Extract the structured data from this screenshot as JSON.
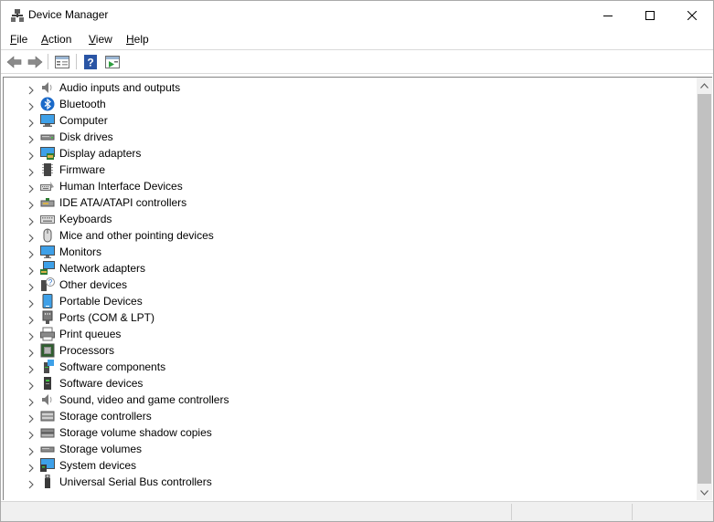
{
  "window": {
    "title": "Device Manager",
    "app_icon": "device-manager-icon"
  },
  "menu": [
    {
      "label": "File",
      "mnemonic": "F",
      "rest": "ile"
    },
    {
      "label": "Action",
      "mnemonic": "A",
      "rest": "ction"
    },
    {
      "label": "View",
      "mnemonic": "V",
      "rest": "iew"
    },
    {
      "label": "Help",
      "mnemonic": "H",
      "rest": "elp"
    }
  ],
  "toolbar": {
    "buttons": [
      "back-arrow-icon",
      "forward-arrow-icon",
      "properties-icon",
      "help-icon",
      "scan-hardware-icon"
    ]
  },
  "tree": {
    "items": [
      {
        "label": "Audio inputs and outputs",
        "icon": "speaker-icon"
      },
      {
        "label": "Bluetooth",
        "icon": "bluetooth-icon"
      },
      {
        "label": "Computer",
        "icon": "computer-icon"
      },
      {
        "label": "Disk drives",
        "icon": "disk-drive-icon"
      },
      {
        "label": "Display adapters",
        "icon": "display-adapter-icon"
      },
      {
        "label": "Firmware",
        "icon": "firmware-chip-icon"
      },
      {
        "label": "Human Interface Devices",
        "icon": "hid-icon"
      },
      {
        "label": "IDE ATA/ATAPI controllers",
        "icon": "ide-controller-icon"
      },
      {
        "label": "Keyboards",
        "icon": "keyboard-icon"
      },
      {
        "label": "Mice and other pointing devices",
        "icon": "mouse-icon"
      },
      {
        "label": "Monitors",
        "icon": "monitor-icon"
      },
      {
        "label": "Network adapters",
        "icon": "network-adapter-icon"
      },
      {
        "label": "Other devices",
        "icon": "unknown-device-icon"
      },
      {
        "label": "Portable Devices",
        "icon": "portable-device-icon"
      },
      {
        "label": "Ports (COM & LPT)",
        "icon": "port-icon"
      },
      {
        "label": "Print queues",
        "icon": "printer-icon"
      },
      {
        "label": "Processors",
        "icon": "processor-icon"
      },
      {
        "label": "Software components",
        "icon": "software-component-icon"
      },
      {
        "label": "Software devices",
        "icon": "software-device-icon"
      },
      {
        "label": "Sound, video and game controllers",
        "icon": "sound-controller-icon"
      },
      {
        "label": "Storage controllers",
        "icon": "storage-controller-icon"
      },
      {
        "label": "Storage volume shadow copies",
        "icon": "shadow-copy-icon"
      },
      {
        "label": "Storage volumes",
        "icon": "storage-volume-icon"
      },
      {
        "label": "System devices",
        "icon": "system-device-icon"
      },
      {
        "label": "Universal Serial Bus controllers",
        "icon": "usb-icon"
      }
    ]
  },
  "colors": {
    "accent": "#0078d7",
    "scroll_thumb": "#c1c1c1"
  }
}
